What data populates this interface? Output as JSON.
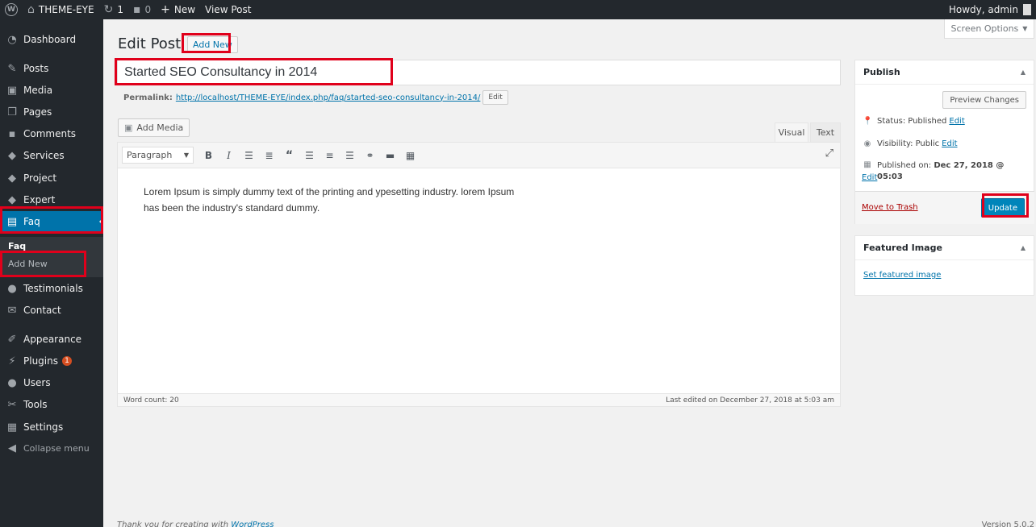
{
  "adminbar": {
    "site_name": "THEME-EYE",
    "updates_count": "1",
    "comments_count": "0",
    "new_label": "New",
    "view_post_label": "View Post",
    "howdy": "Howdy, admin"
  },
  "sidebar": {
    "items": [
      {
        "label": "Dashboard",
        "icon": "dashboard-icon"
      },
      {
        "label": "Posts",
        "icon": "pin-icon"
      },
      {
        "label": "Media",
        "icon": "media-icon"
      },
      {
        "label": "Pages",
        "icon": "pages-icon"
      },
      {
        "label": "Comments",
        "icon": "comment-icon"
      },
      {
        "label": "Services",
        "icon": "tag-icon"
      },
      {
        "label": "Project",
        "icon": "tag-icon"
      },
      {
        "label": "Expert",
        "icon": "tag-icon"
      },
      {
        "label": "Faq",
        "icon": "document-icon"
      },
      {
        "label": "Testimonials",
        "icon": "user-icon"
      },
      {
        "label": "Contact",
        "icon": "mail-icon"
      },
      {
        "label": "Appearance",
        "icon": "brush-icon"
      },
      {
        "label": "Plugins",
        "icon": "plugin-icon",
        "badge": "1"
      },
      {
        "label": "Users",
        "icon": "users-icon"
      },
      {
        "label": "Tools",
        "icon": "wrench-icon"
      },
      {
        "label": "Settings",
        "icon": "settings-icon"
      }
    ],
    "submenu": {
      "head": "Faq",
      "item": "Add New"
    },
    "collapse_label": "Collapse menu"
  },
  "screen_options_label": "Screen Options",
  "page": {
    "title": "Edit Post",
    "add_new": "Add New",
    "post_title": "Started SEO Consultancy in 2014",
    "permalink_label": "Permalink:",
    "permalink_url": "http://localhost/THEME-EYE/index.php/faq/started-seo-consultancy-in-2014/",
    "permalink_edit": "Edit"
  },
  "editor": {
    "add_media": "Add Media",
    "tab_visual": "Visual",
    "tab_text": "Text",
    "format": "Paragraph",
    "content": "Lorem Ipsum is simply dummy text of the printing and ypesetting industry. lorem Ipsum has been the industry's standard dummy.",
    "word_count": "Word count: 20",
    "last_edited": "Last edited on December 27, 2018 at 5:03 am"
  },
  "publish": {
    "heading": "Publish",
    "preview": "Preview Changes",
    "status_label": "Status:",
    "status_value": "Published",
    "visibility_label": "Visibility:",
    "visibility_value": "Public",
    "published_label": "Published on:",
    "published_value": "Dec 27, 2018 @ 05:03",
    "edit_label": "Edit",
    "trash": "Move to Trash",
    "update": "Update"
  },
  "featured": {
    "heading": "Featured Image",
    "set": "Set featured image"
  },
  "footer": {
    "thanks": "Thank you for creating with",
    "wordpress": "WordPress",
    "version": "Version 5.0.2"
  },
  "colors": {
    "admin_bg": "#23282d",
    "accent": "#0073aa",
    "update_button": "#0085ba",
    "highlight_box": "#e0001b"
  }
}
